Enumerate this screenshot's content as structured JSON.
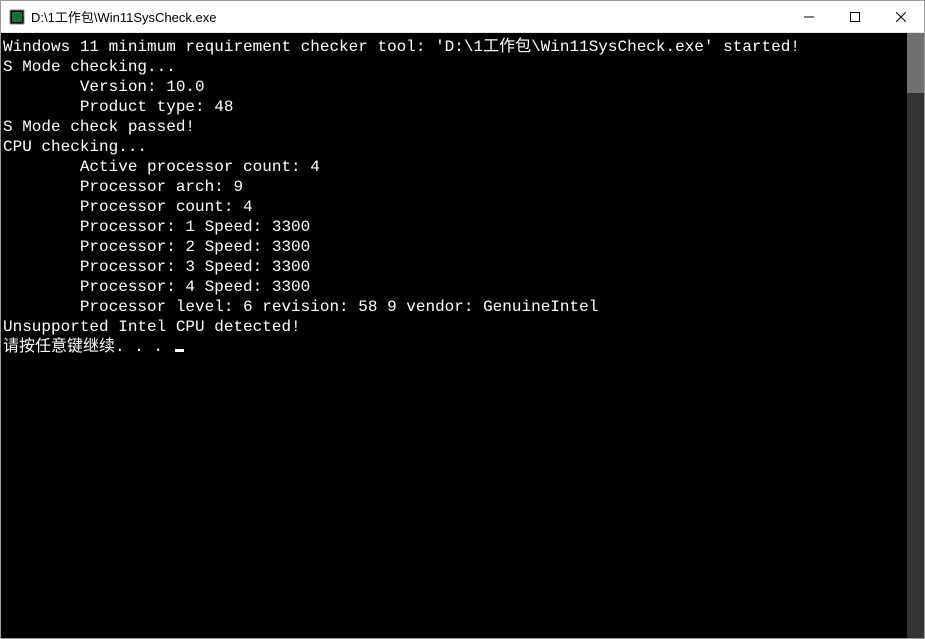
{
  "window": {
    "title": "D:\\1工作包\\Win11SysCheck.exe"
  },
  "console": {
    "lines": [
      "Windows 11 minimum requirement checker tool: 'D:\\1工作包\\Win11SysCheck.exe' started!",
      "S Mode checking...",
      "        Version: 10.0",
      "        Product type: 48",
      "S Mode check passed!",
      "CPU checking...",
      "        Active processor count: 4",
      "        Processor arch: 9",
      "        Processor count: 4",
      "        Processor: 1 Speed: 3300",
      "        Processor: 2 Speed: 3300",
      "        Processor: 3 Speed: 3300",
      "        Processor: 4 Speed: 3300",
      "        Processor level: 6 revision: 58 9 vendor: GenuineIntel",
      "Unsupported Intel CPU detected!"
    ],
    "prompt_line": "请按任意键继续. . . "
  }
}
